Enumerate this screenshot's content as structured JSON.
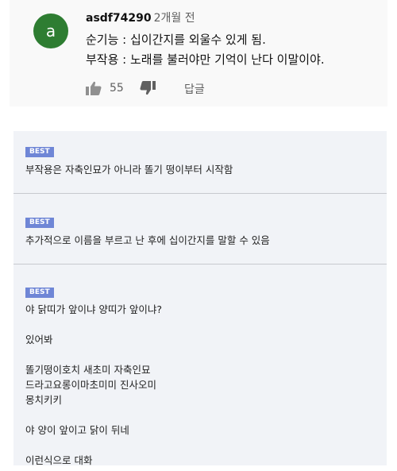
{
  "top_comment": {
    "avatar_letter": "a",
    "author": "asdf74290",
    "time": "2개월 전",
    "lines": [
      "순기능 : 십이간지를 외울수 있게 됨.",
      "부작용 : 노래를 불러야만 기억이 난다 이말이야."
    ],
    "like_count": "55",
    "reply_label": "답글",
    "avatar_color": "#2e7d32"
  },
  "best_badge": "BEST",
  "replies": [
    {
      "text": [
        "부작용은 자축인묘가 아니라 똘기 떵이부터 시작함"
      ]
    },
    {
      "text": [
        "추가적으로 이름을 부르고 난 후에 십이간지를 말할 수 있음"
      ]
    },
    {
      "text": [
        "야 닭띠가 앞이냐 양띠가 앞이냐?",
        "",
        "있어봐",
        "",
        "똘기떵이호치 새초미 자축인묘",
        "드라고요롱이마초미미 진사오미",
        "몽치키키",
        "",
        "야 양이 앞이고 닭이 뒤네",
        "",
        "이런식으로 대화"
      ]
    }
  ]
}
